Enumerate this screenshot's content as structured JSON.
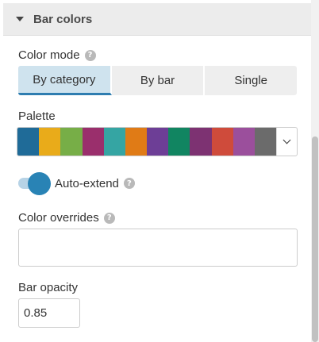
{
  "section": {
    "title": "Bar colors",
    "icon": "caret-down-icon"
  },
  "color_mode": {
    "label": "Color mode",
    "help_icon": "help-icon",
    "options": [
      "By category",
      "By bar",
      "Single"
    ],
    "selected": "By category"
  },
  "palette": {
    "label": "Palette",
    "colors": [
      "#1f6b98",
      "#e9ab1a",
      "#77ae47",
      "#9a2f6c",
      "#35a5a3",
      "#e07b16",
      "#6d3e96",
      "#118561",
      "#7d3272",
      "#cf4b3b",
      "#9b4f9c",
      "#6b6b6b"
    ],
    "dropdown_icon": "chevron-down-icon"
  },
  "auto_extend": {
    "label": "Auto-extend",
    "enabled": true,
    "help_icon": "help-icon"
  },
  "color_overrides": {
    "label": "Color overrides",
    "value": "",
    "help_icon": "help-icon"
  },
  "bar_opacity": {
    "label": "Bar opacity",
    "value": "0.85"
  },
  "accent_color": "#2983b5"
}
